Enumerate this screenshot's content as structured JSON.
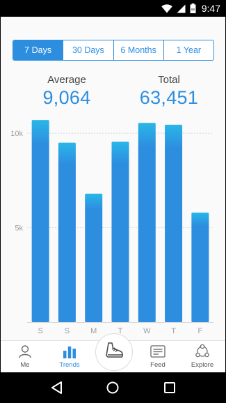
{
  "status_bar": {
    "time": "9:47",
    "icons": [
      "wifi-icon",
      "signal-icon",
      "battery-icon"
    ]
  },
  "segmented": {
    "options": [
      "7 Days",
      "30 Days",
      "6 Months",
      "1 Year"
    ],
    "selected": "7 Days"
  },
  "stats": {
    "average_label": "Average",
    "average_value": "9,064",
    "total_label": "Total",
    "total_value": "63,451"
  },
  "chart_data": {
    "type": "bar",
    "categories": [
      "S",
      "S",
      "M",
      "T",
      "W",
      "T",
      "F"
    ],
    "values": [
      10700,
      9500,
      6800,
      9550,
      10550,
      10450,
      5800
    ],
    "y_tick_labels": [
      "10k",
      "5k"
    ],
    "y_ticks": [
      10000,
      5000
    ],
    "ylim": [
      0,
      11000
    ],
    "grid": true,
    "colors": {
      "bar_top": "#29b6e8",
      "bar_bottom": "#2d8ee0",
      "grid": "#d8d8d8",
      "tick_label": "#9e9e9e"
    }
  },
  "bottom_nav": {
    "items": [
      {
        "label": "Me",
        "icon": "person-icon"
      },
      {
        "label": "Trends",
        "icon": "bar-chart-icon"
      },
      {
        "label": "Feed",
        "icon": "feed-icon"
      },
      {
        "label": "Explore",
        "icon": "explore-icon"
      }
    ],
    "active": "Trends",
    "center_button_icon": "shoe-icon"
  },
  "android_nav": [
    "back-icon",
    "home-icon",
    "recents-icon"
  ],
  "colors": {
    "accent": "#2d8ee0",
    "background": "#fafafa"
  }
}
